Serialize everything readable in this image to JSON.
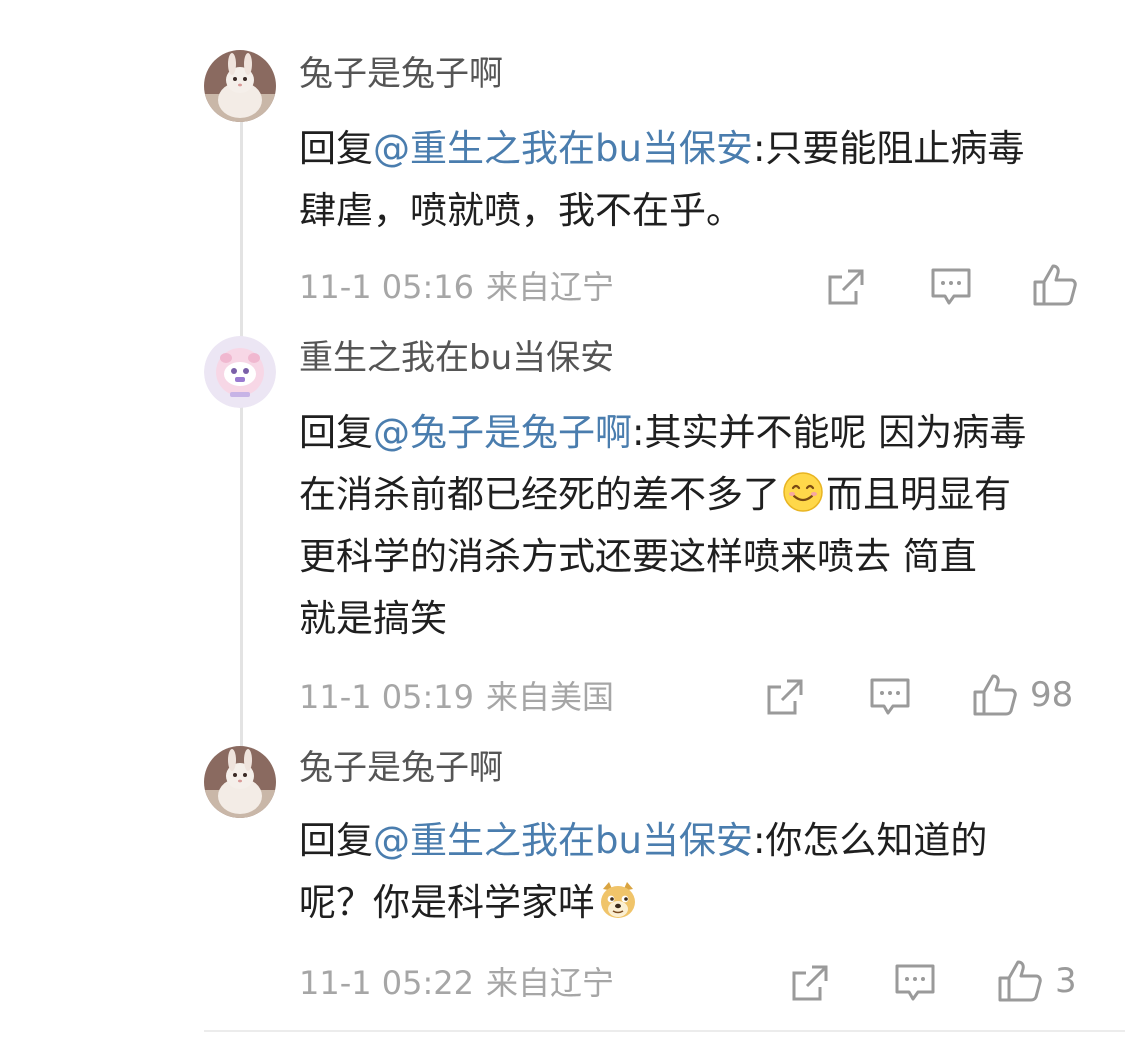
{
  "comments": [
    {
      "username": "兔子是兔子啊",
      "avatar": "rabbit-avatar",
      "reply_prefix": "回复",
      "mention": "@重生之我在bu当保安",
      "colon": ":",
      "text_lines": [
        "只要能阻止病毒",
        "肆虐，喷就喷，我不在乎。"
      ],
      "time": "11-1 05:16",
      "location": "来自辽宁",
      "like_count": ""
    },
    {
      "username": "重生之我在bu当保安",
      "avatar": "pink-cartoon-avatar",
      "reply_prefix": "回复",
      "mention": "@兔子是兔子啊",
      "colon": ":",
      "text_parts": [
        "其实并不能呢 因为病毒",
        "在消杀前都已经死的差不多了",
        "而且明显有",
        "更科学的消杀方式还要这样喷来喷去 简直",
        "就是搞笑"
      ],
      "emoji": "smile-emoji",
      "time": "11-1 05:19",
      "location": "来自美国",
      "like_count": "98"
    },
    {
      "username": "兔子是兔子啊",
      "avatar": "rabbit-avatar",
      "reply_prefix": "回复",
      "mention": "@重生之我在bu当保安",
      "colon": ":",
      "text_parts": [
        "你怎么知道的",
        "呢？你是科学家咩"
      ],
      "emoji": "doge-emoji",
      "time": "11-1 05:22",
      "location": "来自辽宁",
      "like_count": "3"
    }
  ],
  "colors": {
    "mention": "#4a7dae",
    "meta": "#a6a6a6",
    "icon": "#9a9a9a"
  }
}
